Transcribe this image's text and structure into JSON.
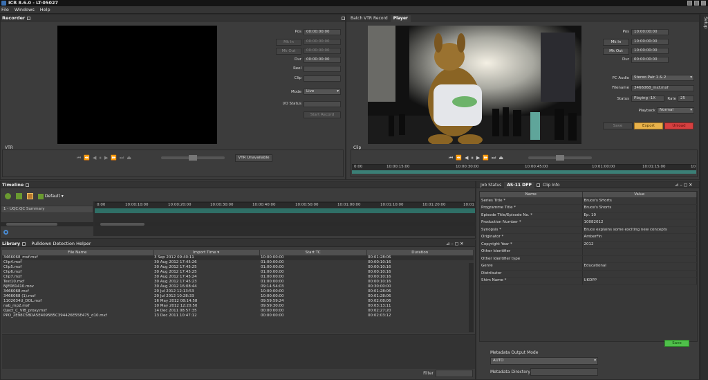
{
  "app": {
    "title": "ICR 8.6.0 - LT-05027"
  },
  "menu": [
    "File",
    "Windows",
    "Help"
  ],
  "side_tab": "Setup",
  "recorder": {
    "title": "Recorder",
    "fields": [
      {
        "label": "Pos",
        "value": "00:00:00:00"
      },
      {
        "label": "Mk In",
        "value": "00:00:00:00"
      },
      {
        "label": "Mk Out",
        "value": "00:00:00:00"
      },
      {
        "label": "Dur",
        "value": "00:00:00:00"
      },
      {
        "label": "Reel",
        "value": ""
      },
      {
        "label": "Clip",
        "value": ""
      }
    ],
    "mode_label": "Mode",
    "mode_value": "Live",
    "io_status_label": "I/O Status",
    "start_record": "Start Record",
    "vtr_label": "VTR",
    "vtr_status": "VTR Unavailable"
  },
  "player_tabs": [
    "Batch VTR Record",
    "Player"
  ],
  "player": {
    "fields": [
      {
        "label": "Pos",
        "value": "10:00:00:00"
      },
      {
        "label": "Mk In",
        "value": "10:00:00:00"
      },
      {
        "label": "Mk Out",
        "value": "10:00:00:00"
      },
      {
        "label": "Dur",
        "value": "00:00:00:00"
      }
    ],
    "pc_audio_label": "PC Audio",
    "pc_audio_value": "Stereo Pair 1 & 2",
    "filename_label": "Filename",
    "filename_value": "3466068_mxf.mxf",
    "status_label": "Status",
    "status_value": "Playing -1X",
    "rate_label": "Rate",
    "rate_value": "25",
    "playback_label": "Playback",
    "playback_value": "Normal",
    "save": "Save",
    "export": "Export",
    "unload": "Unload",
    "clip_label": "Clip",
    "ruler": [
      "0:00",
      "10:00:15:00",
      "10:00:30:00",
      "10:00:45:00",
      "10:01:00:00",
      "10:01:15:00",
      "10"
    ]
  },
  "timeline": {
    "title": "Timeline",
    "preset": "Default",
    "track": "1 - UQC:QC Summary",
    "ruler": [
      "0:00",
      "10:00:10:00",
      "10:00:20:00",
      "10:00:30:00",
      "10:00:40:00",
      "10:00:50:00",
      "10:01:00:00",
      "10:01:10:00",
      "10:01:20:00",
      "10:01"
    ]
  },
  "library": {
    "tabs": [
      "Library",
      "Pulldown Detection Helper"
    ],
    "columns": [
      "File Name",
      "Import Time",
      "Start TC",
      "Duration"
    ],
    "rows": [
      [
        "3466068_mxf.mxf",
        "3 Sep 2012 09:40:11",
        "10:00:00:00",
        "00:01:28:06"
      ],
      [
        "Clip4.mxf",
        "30 Aug 2012 17:45:26",
        "01:00:00:00",
        "00:00:10:16"
      ],
      [
        "Clip5.mxf",
        "30 Aug 2012 17:45:25",
        "01:00:00:00",
        "00:00:10:16"
      ],
      [
        "Clip6.mxf",
        "30 Aug 2012 17:45:25",
        "01:00:00:00",
        "00:00:10:16"
      ],
      [
        "Clip7.mxf",
        "30 Aug 2012 17:45:24",
        "01:00:00:00",
        "00:00:10:16"
      ],
      [
        "Test10.mxf",
        "30 Aug 2012 17:45:23",
        "01:00:00:00",
        "00:00:10:16"
      ],
      [
        "NJE081410.mov",
        "30 Aug 2012 16:08:44",
        "09:14:54:03",
        "00:30:00:00"
      ],
      [
        "3466068.mxf",
        "20 Jul 2012 12:13:53",
        "10:00:00:00",
        "00:01:28:06"
      ],
      [
        "3466068 (1).mxf",
        "20 Jul 2012 10:28:33",
        "10:00:00:00",
        "00:01:28:06"
      ],
      [
        "1102634U_DOL.mxf",
        "16 May 2012 08:14:58",
        "09:59:59:24",
        "00:02:08:06"
      ],
      [
        "nab_mp2.mxf",
        "10 May 2012 12:20:50",
        "09:59:30:00",
        "00:03:13:11"
      ],
      [
        "Oject_C_VIB_proxy.mxf",
        "14 Dec 2011 08:57:35",
        "00:00:00:00",
        "00:02:27:20"
      ],
      [
        "PPO_2E98C5BDA5E4095B5C394426E55E475_d10.mxf",
        "13 Dec 2011 10:47:12",
        "00:00:00:00",
        "00:02:03:12"
      ]
    ],
    "filter_label": "Filter"
  },
  "metadata": {
    "tabs": [
      "Job Status",
      "AS-11 DPP",
      "Clip Info"
    ],
    "columns": [
      "Name",
      "Value"
    ],
    "rows": [
      [
        "Series Title *",
        "Bruce's SHorts"
      ],
      [
        "Programme Title *",
        "Bruce's Shorts"
      ],
      [
        "Episode Title/Episode No. *",
        "Ep. 10"
      ],
      [
        "Production Number *",
        "10082012"
      ],
      [
        "Synopsis *",
        "Bruce explains some exciting new concepts"
      ],
      [
        "Originator *",
        "AmberFin"
      ],
      [
        "Copyright Year *",
        "2012"
      ],
      [
        "Other Identifier",
        ""
      ],
      [
        "Other Identifier type",
        ""
      ],
      [
        "Genre",
        "Educational"
      ],
      [
        "Distributor",
        ""
      ],
      [
        "Shim Name *",
        "UKDPP"
      ]
    ],
    "save": "Save",
    "output_mode_label": "Metadata Output Mode",
    "output_mode_value": "AUTO",
    "directory_label": "Metadata Directory :"
  }
}
